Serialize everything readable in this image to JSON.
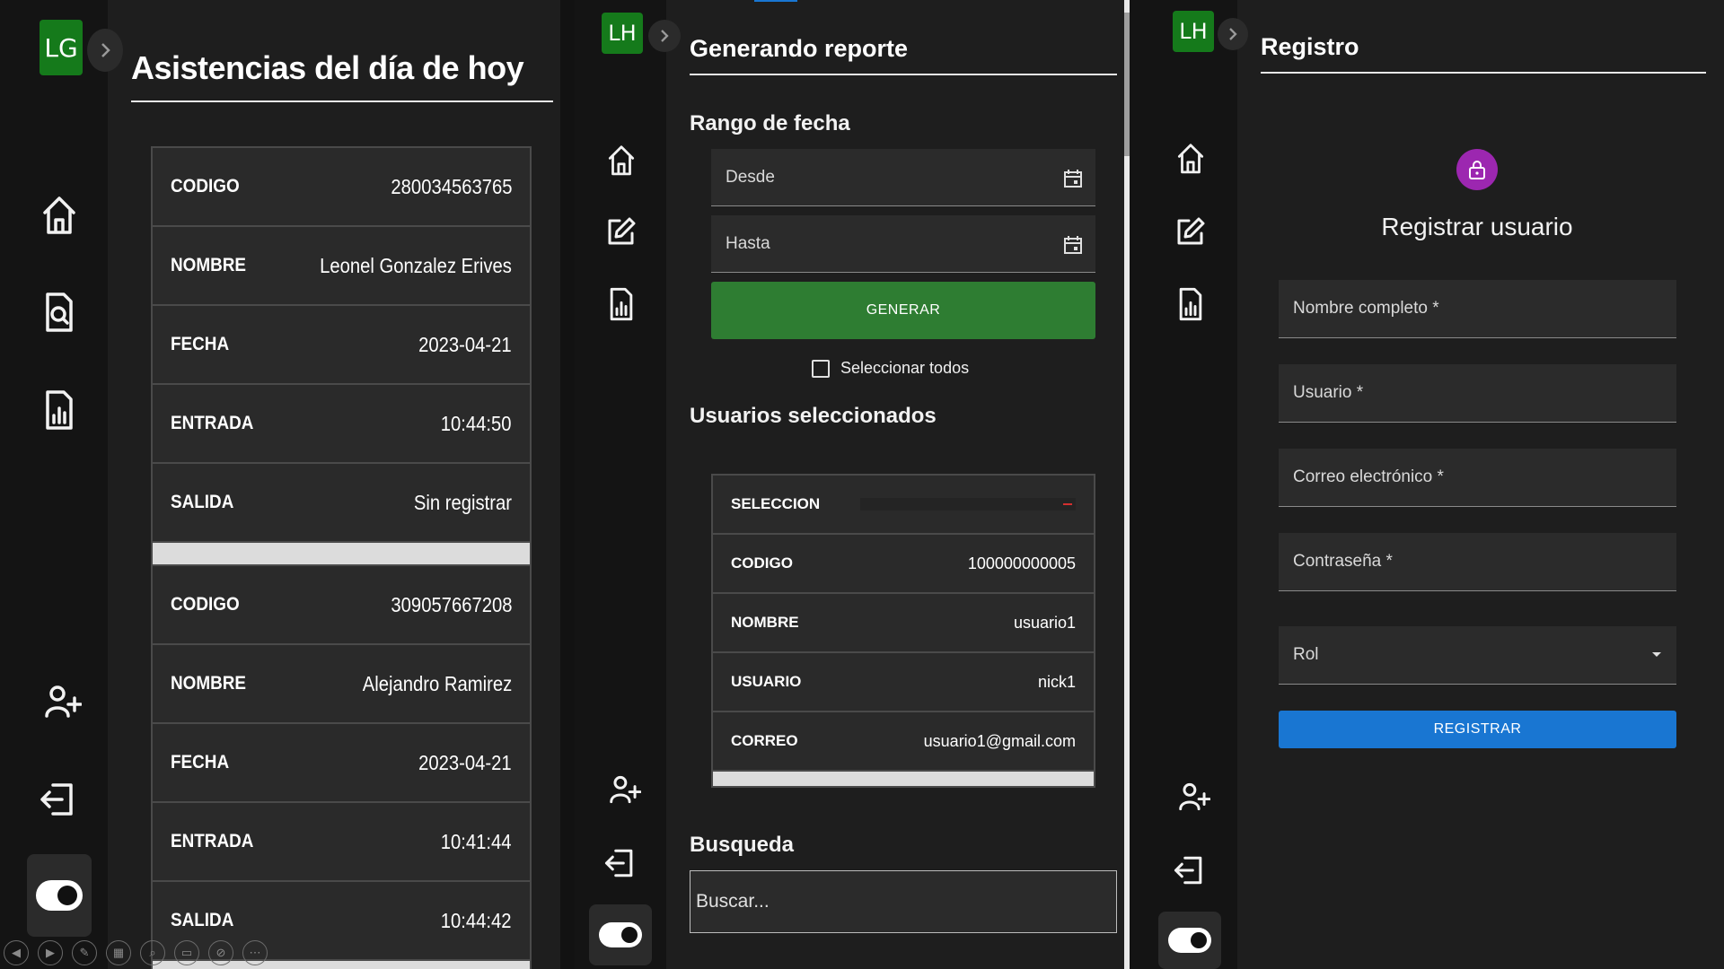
{
  "panel1": {
    "avatar": "LG",
    "title": "Asistencias del día de hoy",
    "records": [
      [
        {
          "label": "CODIGO",
          "value": "280034563765"
        },
        {
          "label": "NOMBRE",
          "value": "Leonel Gonzalez Erives"
        },
        {
          "label": "FECHA",
          "value": "2023-04-21"
        },
        {
          "label": "ENTRADA",
          "value": "10:44:50"
        },
        {
          "label": "SALIDA",
          "value": "Sin registrar"
        }
      ],
      [
        {
          "label": "CODIGO",
          "value": "309057667208"
        },
        {
          "label": "NOMBRE",
          "value": "Alejandro Ramirez"
        },
        {
          "label": "FECHA",
          "value": "2023-04-21"
        },
        {
          "label": "ENTRADA",
          "value": "10:41:44"
        },
        {
          "label": "SALIDA",
          "value": "10:44:42"
        }
      ]
    ]
  },
  "panel2": {
    "avatar": "LH",
    "title": "Generando reporte",
    "date_range_label": "Rango de fecha",
    "from_placeholder": "Desde",
    "to_placeholder": "Hasta",
    "generate_label": "GENERAR",
    "select_all_label": "Seleccionar todos",
    "selected_users_label": "Usuarios seleccionados",
    "selected_table": [
      {
        "label": "SELECCION",
        "value": ""
      },
      {
        "label": "CODIGO",
        "value": "100000000005"
      },
      {
        "label": "NOMBRE",
        "value": "usuario1"
      },
      {
        "label": "USUARIO",
        "value": "nick1"
      },
      {
        "label": "CORREO",
        "value": "usuario1@gmail.com"
      }
    ],
    "search_label": "Busqueda",
    "search_placeholder": "Buscar..."
  },
  "panel3": {
    "avatar": "LH",
    "title": "Registro",
    "form_title": "Registrar usuario",
    "fields": {
      "full_name": "Nombre completo *",
      "username": "Usuario *",
      "email": "Correo electrónico *",
      "password": "Contraseña *",
      "role": "Rol"
    },
    "submit_label": "REGISTRAR"
  },
  "colors": {
    "avatar_green": "#157a1b",
    "generate_green": "#2e7d32",
    "register_blue": "#1976d2",
    "lock_purple": "#9c27b0",
    "remove_red": "#d32f2f"
  },
  "icons": [
    "home-icon",
    "document-search-icon",
    "report-icon",
    "edit-icon",
    "add-user-icon",
    "logout-icon",
    "theme-toggle",
    "calendar-icon",
    "lock-icon",
    "dropdown-arrow-icon",
    "chevron-right-icon"
  ]
}
